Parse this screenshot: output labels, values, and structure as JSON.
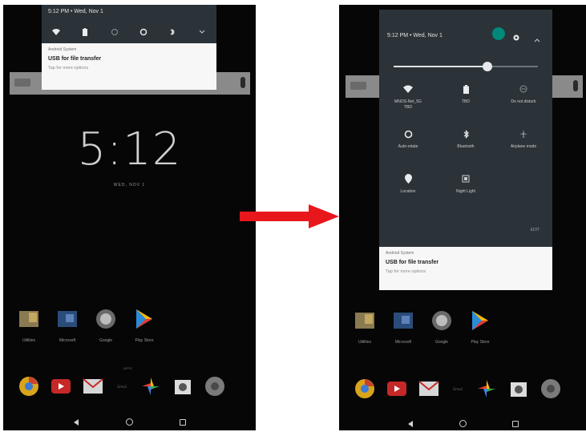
{
  "left_screen": {
    "status_time": "5:12 PM • Wed, Nov 1",
    "notification": {
      "app": "Android System",
      "title": "USB for file transfer",
      "subtitle": "Tap for more options"
    },
    "clock_time": "5:12",
    "clock_date": "WED, NOV 1",
    "apps": [
      {
        "label": "Utilities",
        "icon": "folder-icon"
      },
      {
        "label": "Microsoft",
        "icon": "folder-icon"
      },
      {
        "label": "Google",
        "icon": "folder-icon"
      },
      {
        "label": "Play Store",
        "icon": "play-store-icon"
      }
    ],
    "dock_label": "Gmail",
    "apps_drawer_label": "APPS"
  },
  "right_screen": {
    "status_time": "5:12 PM • Wed, Nov 1",
    "brightness_level": 0.65,
    "tiles": [
      {
        "label": "MNOS-Net_5G",
        "label2": "TBD",
        "icon": "wifi-icon"
      },
      {
        "label": "TBD",
        "icon": "battery-icon"
      },
      {
        "label": "Do not disturb",
        "icon": "dnd-icon"
      },
      {
        "label": "Auto-rotate",
        "icon": "rotate-icon"
      },
      {
        "label": "Bluetooth",
        "icon": "bluetooth-icon"
      },
      {
        "label": "Airplane mode",
        "icon": "airplane-icon"
      },
      {
        "label": "Location",
        "icon": "location-icon"
      },
      {
        "label": "Night Light",
        "icon": "night-light-icon"
      }
    ],
    "edit_label": "EDIT",
    "notification": {
      "app": "Android System",
      "title": "USB for file transfer",
      "subtitle": "Tap for more options"
    },
    "apps": [
      {
        "label": "Utilities",
        "icon": "folder-icon"
      },
      {
        "label": "Microsoft",
        "icon": "folder-icon"
      },
      {
        "label": "Google",
        "icon": "folder-icon"
      },
      {
        "label": "Play Store",
        "icon": "play-store-icon"
      }
    ],
    "dock_label": "Gmail"
  },
  "colors": {
    "arrow": "#e8171c",
    "shade": "#2c3338",
    "accent": "#00897b"
  }
}
